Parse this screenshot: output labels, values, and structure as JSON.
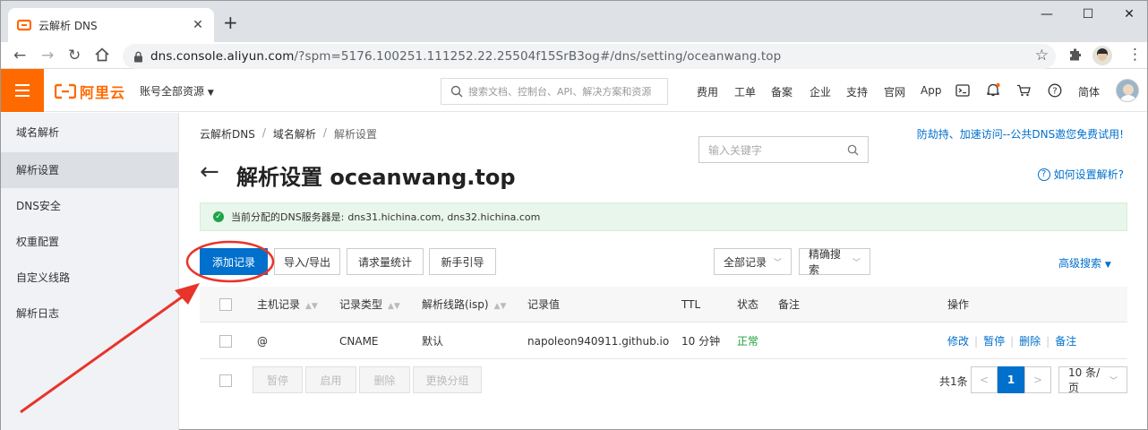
{
  "browser": {
    "tab_title": "云解析 DNS",
    "tab_close": "✕",
    "new_tab": "+",
    "window_controls": [
      "—",
      "☐",
      "✕"
    ],
    "url_host": "dns.console.aliyun.com",
    "url_path": "/?spm=5176.100251.111252.22.25504f15SrB3og#/dns/setting/oceanwang.top"
  },
  "header": {
    "brand": "阿里云",
    "account_scope": "账号全部资源",
    "search_placeholder": "搜索文档、控制台、API、解决方案和资源",
    "nav": [
      "费用",
      "工单",
      "备案",
      "企业",
      "支持",
      "官网",
      "App"
    ],
    "language": "简体"
  },
  "sidebar": {
    "items": [
      "域名解析",
      "解析设置",
      "DNS安全",
      "权重配置",
      "自定义线路",
      "解析日志"
    ],
    "active_index": 1
  },
  "breadcrumb": [
    "云解析DNS",
    "域名解析",
    "解析设置"
  ],
  "promo_link": "防劫持、加速访问--公共DNS邀您免费试用!",
  "page_title": "解析设置 oceanwang.top",
  "help_link": "如何设置解析?",
  "notice": {
    "label": "当前分配的DNS服务器是:",
    "servers": "dns31.hichina.com, dns32.hichina.com"
  },
  "actions": {
    "add_record": "添加记录",
    "import_export": "导入/导出",
    "request_stats": "请求量统计",
    "guide": "新手引导",
    "all_records": "全部记录",
    "exact_search": "精确搜索",
    "keyword_placeholder": "输入关键字",
    "advanced_search": "高级搜索"
  },
  "table": {
    "columns": [
      "主机记录",
      "记录类型",
      "解析线路(isp)",
      "记录值",
      "TTL",
      "状态",
      "备注",
      "操作"
    ],
    "rows": [
      {
        "host": "@",
        "type": "CNAME",
        "line": "默认",
        "value": "napoleon940911.github.io",
        "ttl": "10 分钟",
        "status": "正常",
        "remark": "",
        "ops": [
          "修改",
          "暂停",
          "删除",
          "备注"
        ]
      }
    ]
  },
  "bulk_actions": [
    "暂停",
    "启用",
    "删除",
    "更换分组"
  ],
  "pagination": {
    "total": "共1条",
    "current_page": "1",
    "page_size": "10 条/页",
    "prev": "<",
    "next": ">"
  },
  "colors": {
    "brand_orange": "#ff6a00",
    "primary_blue": "#0070cc",
    "annotation_red": "#e8342b",
    "status_green": "#1e9e3f"
  }
}
